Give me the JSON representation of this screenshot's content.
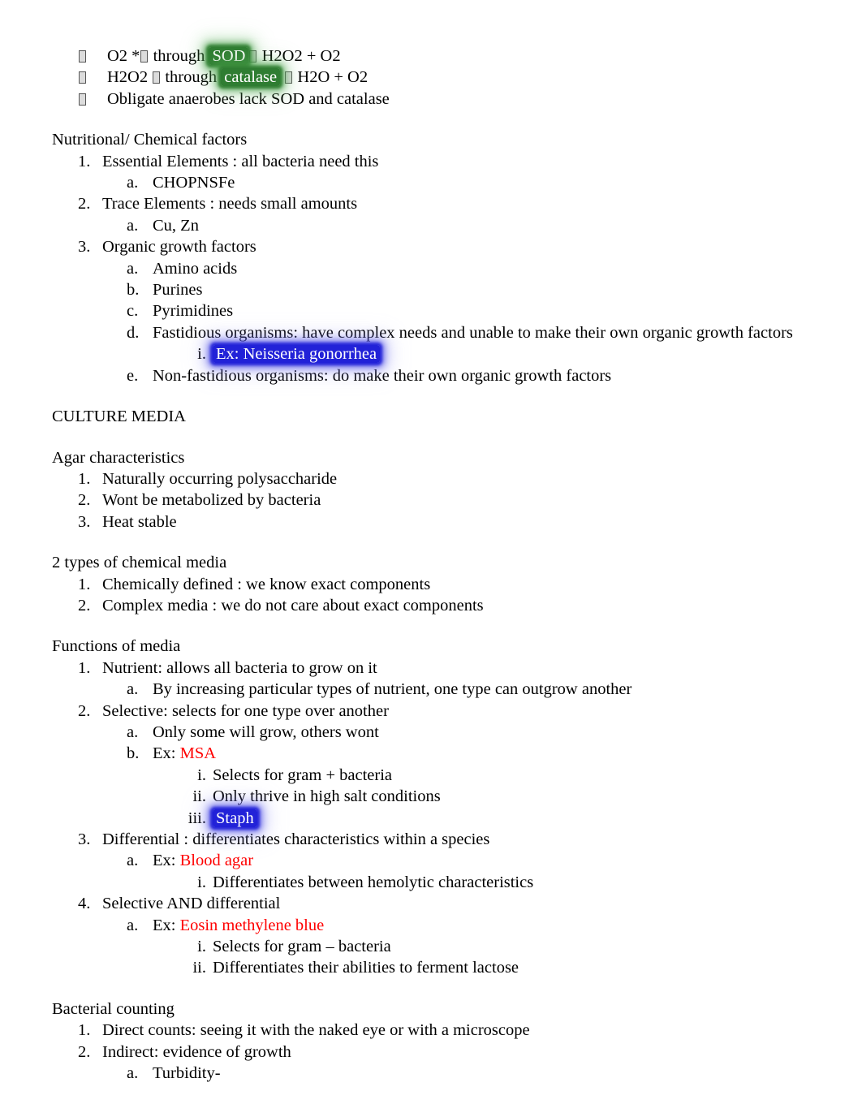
{
  "document": {
    "background": "#ffffff",
    "text_color": "#000000",
    "accent_red": "#ff0000",
    "highlight_green": "#2f7d32",
    "highlight_blue": "#2222d8",
    "bullet_glyph": "missing-glyph-box",
    "arrow_glyph": "missing-glyph-box"
  },
  "oxygen_block": {
    "line1": {
      "pre": "O2 *",
      "mid": " through ",
      "highlight": "SOD",
      "post": " H2O2 + O2"
    },
    "line2": {
      "pre": "H2O2 ",
      "mid": " through ",
      "highlight": "catalase",
      "post": " H2O + O2"
    },
    "line3": "Obligate anaerobes lack SOD and catalase"
  },
  "nutritional": {
    "heading": "Nutritional/ Chemical factors",
    "items": [
      {
        "marker": "1.",
        "text": "Essential Elements    : all bacteria need this"
      },
      {
        "marker": "a.",
        "text": "CHOPNSFe"
      },
      {
        "marker": "2.",
        "text": "Trace Elements   : needs small amounts"
      },
      {
        "marker": "a.",
        "text": "Cu, Zn"
      },
      {
        "marker": "3.",
        "text": "Organic growth factors"
      },
      {
        "marker": "a.",
        "text": "Amino acids"
      },
      {
        "marker": "b.",
        "text": "Purines"
      },
      {
        "marker": "c.",
        "text": "Pyrimidines"
      },
      {
        "marker": "d.",
        "text": "Fastidious organisms: have complex needs and unable to make their own organic growth factors"
      },
      {
        "marker": "i.",
        "text": "Ex: Neisseria gonorrhea",
        "highlight": "blue"
      },
      {
        "marker": "e.",
        "text": "Non-fastidious organisms: do make their own organic growth factors"
      }
    ]
  },
  "culture_media": {
    "heading": "CULTURE MEDIA"
  },
  "agar": {
    "heading": "Agar characteristics",
    "items": [
      {
        "marker": "1.",
        "text": "Naturally occurring polysaccharide"
      },
      {
        "marker": "2.",
        "text": "Wont be metabolized by bacteria"
      },
      {
        "marker": "3.",
        "text": "Heat stable"
      }
    ]
  },
  "chemical_media": {
    "heading": "2 types of chemical media",
    "items": [
      {
        "marker": "1.",
        "text": "Chemically defined   : we know exact components"
      },
      {
        "marker": "2.",
        "text": "Complex media  : we do not care about exact components"
      }
    ]
  },
  "functions_of_media": {
    "heading": "Functions of media",
    "items": [
      {
        "marker": "1.",
        "text": "Nutrient:   allows all bacteria to grow on it"
      },
      {
        "marker": "a.",
        "text": "By increasing particular types of nutrient, one type can outgrow another"
      },
      {
        "marker": "2.",
        "text": "Selective:   selects for one type over another"
      },
      {
        "marker": "a.",
        "text": "Only some will grow, others wont"
      },
      {
        "marker": "b.",
        "prefix": "Ex: ",
        "red": "MSA"
      },
      {
        "marker": "i.",
        "text": "Selects for gram + bacteria"
      },
      {
        "marker": "ii.",
        "text": "Only thrive in high salt conditions"
      },
      {
        "marker": "iii.",
        "text": "Staph",
        "highlight": "blue"
      },
      {
        "marker": "3.",
        "text": "Differential  : differentiates characteristics within a species"
      },
      {
        "marker": "a.",
        "prefix": "Ex: ",
        "red": "Blood agar"
      },
      {
        "marker": "i.",
        "text": "Differentiates between hemolytic characteristics"
      },
      {
        "marker": "4.",
        "text": "Selective AND differential"
      },
      {
        "marker": "a.",
        "prefix": "Ex: ",
        "red": "Eosin methylene blue"
      },
      {
        "marker": "i.",
        "text": "Selects for gram – bacteria"
      },
      {
        "marker": "ii.",
        "text": "Differentiates their abilities to ferment lactose"
      }
    ]
  },
  "bacterial_counting": {
    "heading": "Bacterial counting",
    "items": [
      {
        "marker": "1.",
        "text": "Direct counts: seeing it with the naked eye or with a microscope"
      },
      {
        "marker": "2.",
        "text": "Indirect: evidence of growth"
      },
      {
        "marker": "a.",
        "text": "Turbidity-"
      }
    ]
  }
}
